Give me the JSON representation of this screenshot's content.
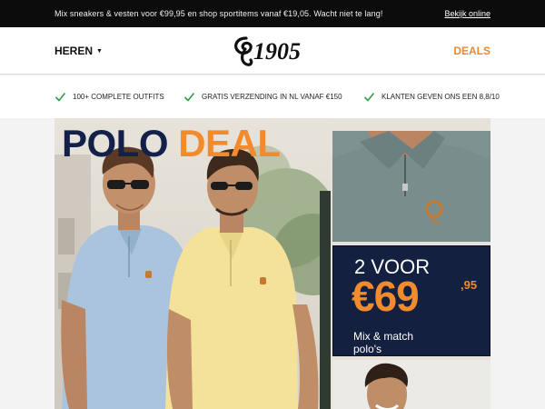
{
  "topbar": {
    "promo_text": "Mix sneakers & vesten voor €99,95 en shop sportitems vanaf €19,05. Wacht niet te lang!",
    "view_online_label": "Bekijk online"
  },
  "header": {
    "nav_left_label": "HEREN",
    "logo_text": "1905",
    "nav_right_label": "DEALS"
  },
  "usps": [
    {
      "label": "100+ COMPLETE OUTFITS"
    },
    {
      "label": "GRATIS VERZENDING IN NL VANAF €150"
    },
    {
      "label": "KLANTEN GEVEN ONS EEN 8,8/10"
    }
  ],
  "hero": {
    "headline_word1": "POLO",
    "headline_word2": "DEAL",
    "promo": {
      "line1": "2 VOOR",
      "price": "€69",
      "cents": ",95",
      "sub1": "Mix & match",
      "sub2": "polo's"
    }
  },
  "colors": {
    "topbar_bg": "#0c0c0c",
    "accent_orange": "#e98a2b",
    "navy": "#13204a",
    "check_green": "#2e9e48",
    "polo_blue": "#a9c4dc",
    "polo_yellow": "#f4e29a",
    "polo_sage": "#7b8d8d"
  }
}
